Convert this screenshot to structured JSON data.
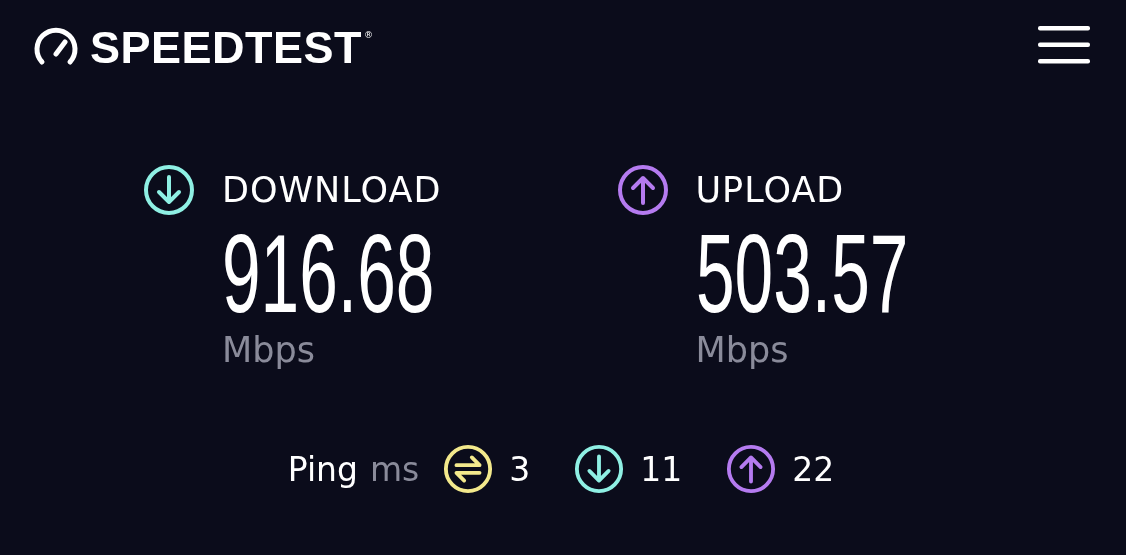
{
  "header": {
    "logo_text": "SPEEDTEST",
    "logo_mark": "®"
  },
  "results": [
    {
      "kind": "download",
      "label": "DOWNLOAD",
      "value": "916.68",
      "unit": "Mbps"
    },
    {
      "kind": "upload",
      "label": "UPLOAD",
      "value": "503.57",
      "unit": "Mbps"
    }
  ],
  "ping": {
    "label": "Ping",
    "unit": "ms",
    "items": [
      {
        "kind": "idle",
        "value": "3"
      },
      {
        "kind": "download",
        "value": "11"
      },
      {
        "kind": "upload",
        "value": "22"
      }
    ]
  }
}
